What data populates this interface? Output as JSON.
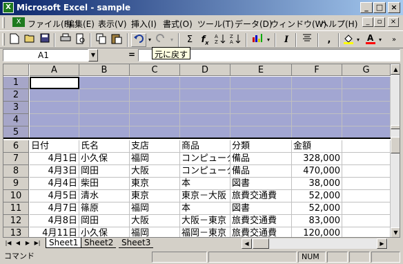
{
  "window": {
    "title": "Microsoft Excel - sample",
    "app_icon": "X"
  },
  "menu": [
    {
      "label": "ファイル(F)"
    },
    {
      "label": "編集(E)"
    },
    {
      "label": "表示(V)"
    },
    {
      "label": "挿入(I)"
    },
    {
      "label": "書式(O)"
    },
    {
      "label": "ツール(T)"
    },
    {
      "label": "データ(D)"
    },
    {
      "label": "ウィンドウ(W)"
    },
    {
      "label": "ヘルプ(H)"
    }
  ],
  "toolbar": {
    "tooltip": "元に戻す",
    "icons": [
      "new-icon",
      "open-icon",
      "save-icon",
      "print-icon",
      "print-preview-icon",
      "copy-icon",
      "paste-icon",
      "undo-icon",
      "redo-icon",
      "sum-icon",
      "function-icon",
      "sort-asc-icon",
      "sort-desc-icon",
      "chart-icon",
      "italic-icon",
      "align-center-icon",
      "comma-icon",
      "fill-color-icon",
      "font-color-icon"
    ],
    "glyphs": {
      "sum": "Σ",
      "fx": "f",
      "italic": "I",
      "comma": ","
    }
  },
  "formula_bar": {
    "name_box": "A1",
    "equals": "=",
    "formula": ""
  },
  "columns": [
    "A",
    "B",
    "C",
    "D",
    "E",
    "F",
    "G"
  ],
  "rows": [
    {
      "n": "1",
      "cells": [
        "",
        "",
        "",
        "",
        "",
        "",
        ""
      ]
    },
    {
      "n": "2",
      "cells": [
        "",
        "",
        "",
        "",
        "",
        "",
        ""
      ]
    },
    {
      "n": "3",
      "cells": [
        "",
        "",
        "",
        "",
        "",
        "",
        ""
      ]
    },
    {
      "n": "4",
      "cells": [
        "",
        "",
        "",
        "",
        "",
        "",
        ""
      ]
    },
    {
      "n": "5",
      "cells": [
        "",
        "",
        "",
        "",
        "",
        "",
        ""
      ]
    },
    {
      "n": "6",
      "cells": [
        "日付",
        "氏名",
        "支店",
        "商品",
        "分類",
        "金額",
        ""
      ]
    },
    {
      "n": "7",
      "cells": [
        "4月1日",
        "小久保",
        "福岡",
        "コンピュータ",
        "備品",
        "328,000",
        ""
      ]
    },
    {
      "n": "8",
      "cells": [
        "4月3日",
        "岡田",
        "大阪",
        "コンピュータ",
        "備品",
        "470,000",
        ""
      ]
    },
    {
      "n": "9",
      "cells": [
        "4月4日",
        "柴田",
        "東京",
        "本",
        "図書",
        "38,000",
        ""
      ]
    },
    {
      "n": "10",
      "cells": [
        "4月5日",
        "清水",
        "東京",
        "東京－大阪",
        "旅費交通費",
        "52,000",
        ""
      ]
    },
    {
      "n": "11",
      "cells": [
        "4月7日",
        "篠原",
        "福岡",
        "本",
        "図書",
        "52,000",
        ""
      ]
    },
    {
      "n": "12",
      "cells": [
        "4月8日",
        "岡田",
        "大阪",
        "大阪－東京",
        "旅費交通費",
        "83,000",
        ""
      ]
    },
    {
      "n": "13",
      "cells": [
        "4月11日",
        "小久保",
        "福岡",
        "福岡－東京",
        "旅費交通費",
        "120,000",
        ""
      ]
    }
  ],
  "sheets": [
    "Sheet1",
    "Sheet2",
    "Sheet3"
  ],
  "status": {
    "mode": "コマンド",
    "num": "NUM"
  },
  "colors": {
    "selection": "#a2a6d2",
    "title_start": "#0a246a",
    "title_end": "#a6caf0"
  }
}
